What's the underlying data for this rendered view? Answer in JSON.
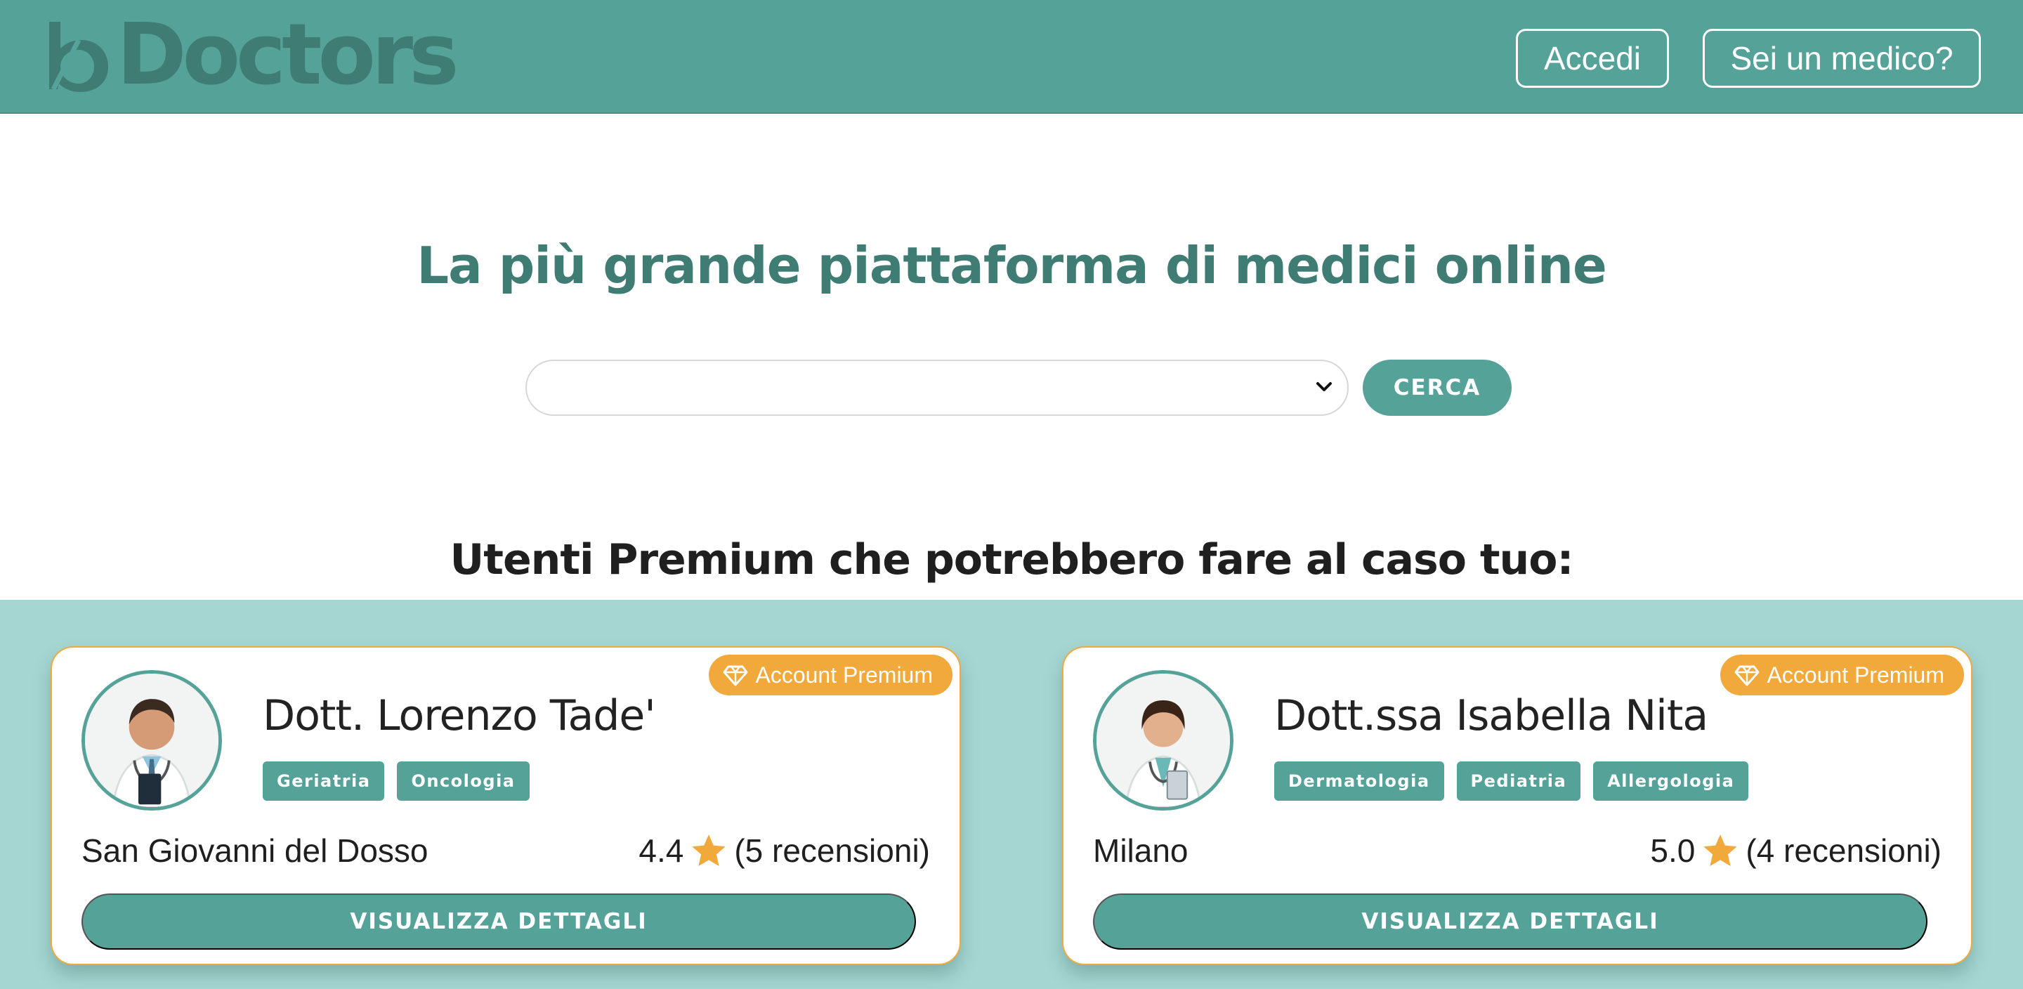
{
  "header": {
    "logo_text": "Doctors",
    "login_label": "Accedi",
    "doctor_label": "Sei un medico?"
  },
  "hero": {
    "title": "La più grande piattaforma di medici online",
    "search_selected": "",
    "search_button": "CERCA"
  },
  "premium": {
    "section_title": "Utenti Premium che potrebbero fare al caso tuo:",
    "cards": [
      {
        "badge": "Account Premium",
        "name": "Dott. Lorenzo Tade'",
        "specialties": [
          "Geriatria",
          "Oncologia"
        ],
        "city": "San Giovanni del Dosso",
        "rating": "4.4",
        "reviews": "(5 recensioni)",
        "details_button": "VISUALIZZA DETTAGLI"
      },
      {
        "badge": "Account Premium",
        "name": "Dott.ssa Isabella Nita",
        "specialties": [
          "Dermatologia",
          "Pediatria",
          "Allergologia"
        ],
        "city": "Milano",
        "rating": "5.0",
        "reviews": "(4 recensioni)",
        "details_button": "VISUALIZZA DETTAGLI"
      }
    ]
  },
  "icons": {
    "badge": "diamond-icon",
    "rating": "star-icon",
    "select": "chevron-down-icon"
  },
  "colors": {
    "primary": "#55a298",
    "logo": "#3f7c74",
    "premium_band": "#a6d6d1",
    "accent": "#f0a93a"
  }
}
